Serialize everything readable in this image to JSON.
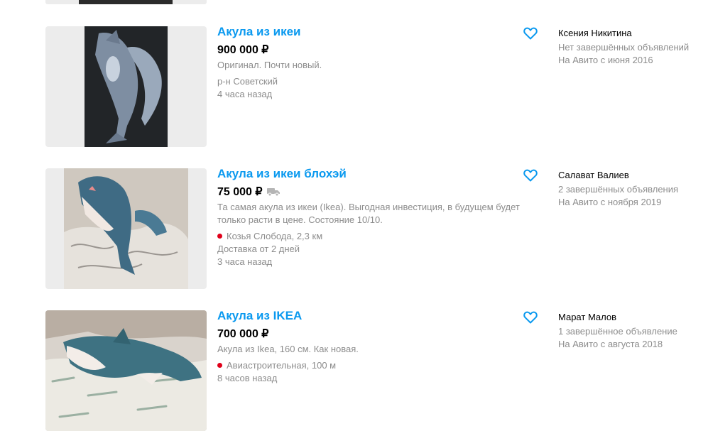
{
  "listings": [
    {
      "title": "Акула из икеи",
      "price": "900 000 ₽",
      "delivery_icon": "",
      "description": "Оригинал. Почти новый.",
      "location": "р-н Советский",
      "metro_color": "",
      "delivery_text": "",
      "posted": "4 часа назад",
      "favorite_icon": "heart-outline-icon",
      "seller": {
        "name": "Ксения Никитина",
        "listings_stat": "Нет завершённых объявлений",
        "member_since": "На Авито с июня 2016"
      }
    },
    {
      "title": "Акула из икеи блохэй",
      "price": "75 000 ₽",
      "delivery_icon": "truck-icon",
      "description": "Та самая акула из икеи (Ikea). Выгодная инвестиция, в будущем будет только расти в цене. Состояние 10/10.",
      "location": "Козья Слобода, 2,3 км",
      "metro_color": "#e0001a",
      "delivery_text": "Доставка от 2 дней",
      "posted": "3 часа назад",
      "favorite_icon": "heart-outline-icon",
      "seller": {
        "name": "Салават Валиев",
        "listings_stat": "2 завершённых объявления",
        "member_since": "На Авито с ноября 2019"
      }
    },
    {
      "title": "Акула из IKEA",
      "price": "700 000 ₽",
      "delivery_icon": "",
      "description": "Акула из Ikea, 160 см. Как новая.",
      "location": "Авиастроительная, 100 м",
      "metro_color": "#e0001a",
      "delivery_text": "",
      "posted": "8 часов назад",
      "favorite_icon": "heart-outline-icon",
      "seller": {
        "name": "Марат Малов",
        "listings_stat": "1 завершённое объявление",
        "member_since": "На Авито с августа 2018"
      }
    }
  ],
  "colors": {
    "link": "#0a99ef",
    "muted": "#8c8c8c",
    "metro": "#e0001a"
  }
}
